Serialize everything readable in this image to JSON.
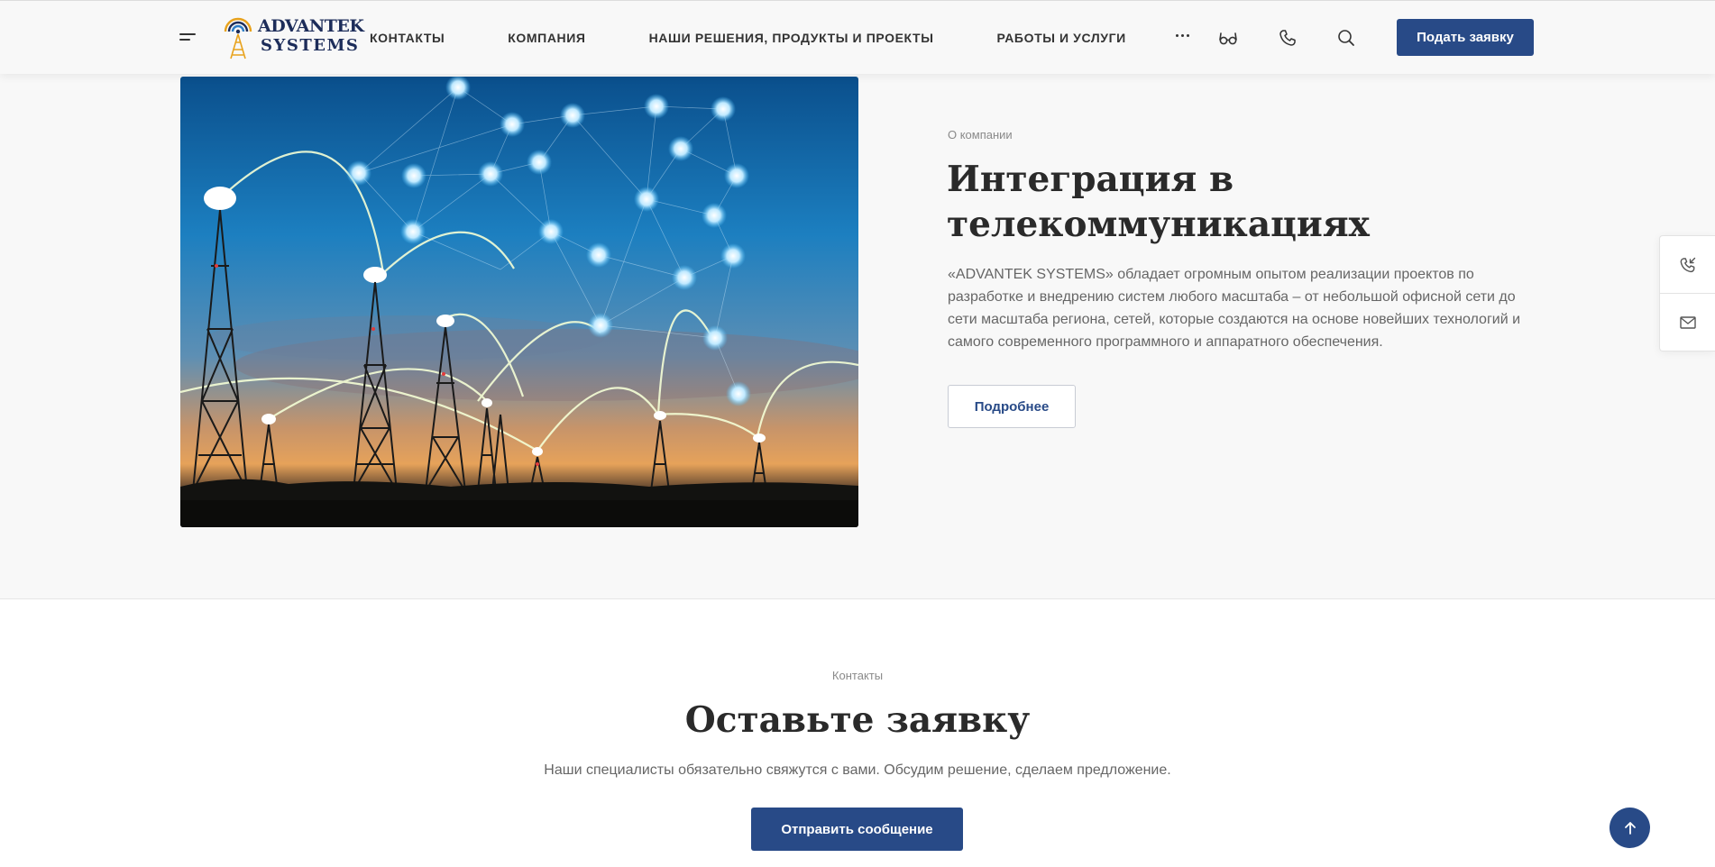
{
  "header": {
    "logo": {
      "line1": "ADVANTEK",
      "line2": "SYSTEMS"
    },
    "nav": [
      {
        "label": "КОНТАКТЫ"
      },
      {
        "label": "КОМПАНИЯ"
      },
      {
        "label": "НАШИ РЕШЕНИЯ, ПРОДУКТЫ И ПРОЕКТЫ"
      },
      {
        "label": "РАБОТЫ И УСЛУГИ"
      }
    ],
    "icons": [
      "menu-icon",
      "more-dots-icon",
      "glasses-icon",
      "phone-icon",
      "search-icon"
    ],
    "cta_label": "Подать заявку"
  },
  "about": {
    "eyebrow": "О компании",
    "title": "Интеграция в телекоммуникациях",
    "text": "«ADVANTEK SYSTEMS» обладает огромным опытом реализации проектов по разработке и внедрению систем любого масштаба – от небольшой офисной сети до сети масштаба региона, сетей, которые создаются на основе новейших технологий и самого современного программного и аппаратного обеспечения.",
    "button_label": "Подробнее"
  },
  "side_panel": {
    "icons": [
      "callback-phone-icon",
      "mail-icon"
    ]
  },
  "contacts": {
    "eyebrow": "Контакты",
    "title": "Оставьте заявку",
    "text": "Наши специалисты обязательно свяжутся с вами. Обсудим решение, сделаем предложение.",
    "button_label": "Отправить сообщение"
  },
  "colors": {
    "accent": "#284a87",
    "section_bg": "#f8f8f8",
    "text_dark": "#2a2a2a",
    "text_muted": "#666666"
  }
}
